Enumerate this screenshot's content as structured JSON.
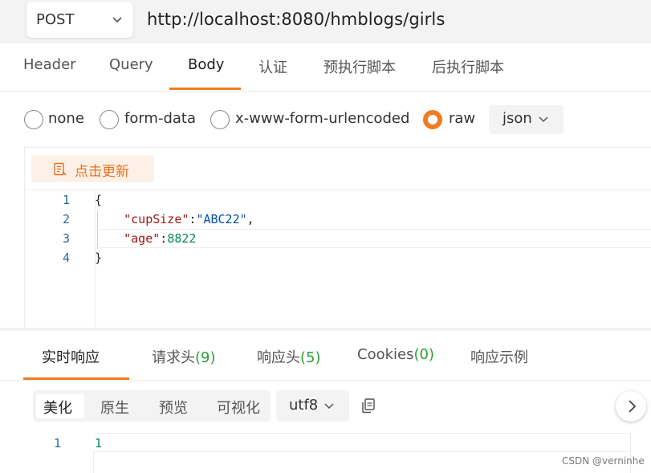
{
  "request": {
    "method": "POST",
    "url": "http://localhost:8080/hmblogs/girls"
  },
  "request_tabs": [
    {
      "label": "Header",
      "active": false
    },
    {
      "label": "Query",
      "active": false
    },
    {
      "label": "Body",
      "active": true
    },
    {
      "label": "认证",
      "active": false
    },
    {
      "label": "预执行脚本",
      "active": false
    },
    {
      "label": "后执行脚本",
      "active": false
    }
  ],
  "body_types": [
    {
      "label": "none",
      "selected": false
    },
    {
      "label": "form-data",
      "selected": false
    },
    {
      "label": "x-www-form-urlencoded",
      "selected": false
    },
    {
      "label": "raw",
      "selected": true
    }
  ],
  "raw_format": "json",
  "editor": {
    "beautify_label": "点击更新",
    "line_numbers": [
      "1",
      "2",
      "3",
      "4"
    ],
    "lines": {
      "l1": "{",
      "l2_key": "\"cupSize\"",
      "l2_colon": ":",
      "l2_val": "\"ABC22\"",
      "l2_comma": ",",
      "l3_key": "\"age\"",
      "l3_colon": ":",
      "l3_val": "8822",
      "l4": "}"
    }
  },
  "response_tabs": [
    {
      "label": "实时响应",
      "count": "",
      "active": true
    },
    {
      "label": "请求头",
      "count": "(9)",
      "active": false
    },
    {
      "label": "响应头",
      "count": "(5)",
      "active": false
    },
    {
      "label": "Cookies",
      "count": "(0)",
      "active": false
    },
    {
      "label": "响应示例",
      "count": "",
      "active": false
    }
  ],
  "response_view_modes": [
    {
      "label": "美化",
      "active": true
    },
    {
      "label": "原生",
      "active": false
    },
    {
      "label": "预览",
      "active": false
    },
    {
      "label": "可视化",
      "active": false
    }
  ],
  "response_encoding": "utf8",
  "response_body": {
    "line_number": "1",
    "content": "1"
  },
  "watermark": "CSDN @verninhe",
  "colors": {
    "accent": "#f07c20",
    "count_green": "#2aa232",
    "json_key": "#a31515",
    "json_string": "#0451a5",
    "json_number": "#098658"
  }
}
